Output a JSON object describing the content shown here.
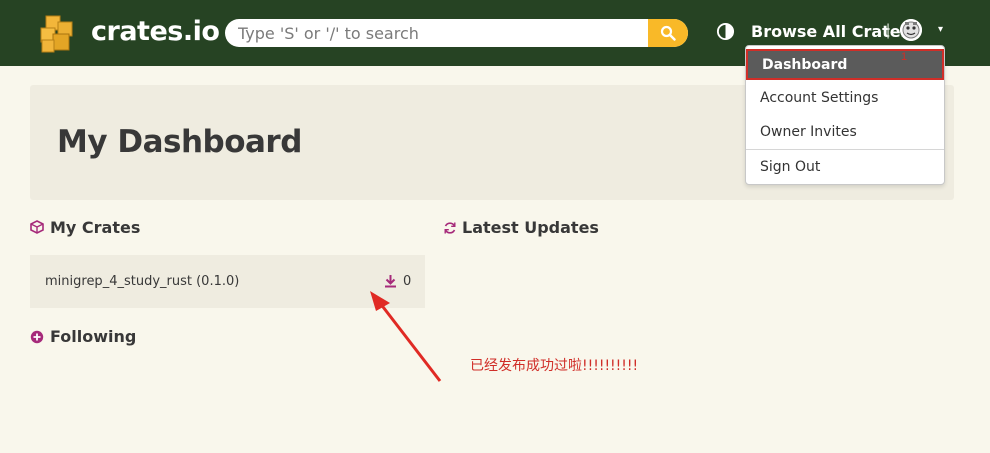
{
  "header": {
    "logo_text": "crates.io",
    "search_placeholder": "Type 'S' or '/' to search",
    "browse_label": "Browse All Crates",
    "separator": "|",
    "caret": "▾"
  },
  "user_menu": {
    "items": [
      {
        "label": "Dashboard",
        "active": true
      },
      {
        "label": "Account Settings"
      },
      {
        "label": "Owner Invites"
      },
      {
        "label": "Sign Out"
      }
    ]
  },
  "dashboard": {
    "title": "My Dashboard",
    "my_crates_heading": "My Crates",
    "latest_updates_heading": "Latest Updates",
    "following_heading": "Following",
    "crates": [
      {
        "name": "minigrep_4_study_rust (0.1.0)",
        "downloads": "0"
      }
    ]
  },
  "annotations": {
    "menu_marker": "1",
    "note": "已经发布成功过啦!!!!!!!!!!",
    "color": "#d02e28"
  },
  "colors": {
    "header_bg": "#264323",
    "page_bg": "#f9f7ec",
    "accent_yellow": "#f9b928",
    "icon_purple": "#a62a7a"
  }
}
